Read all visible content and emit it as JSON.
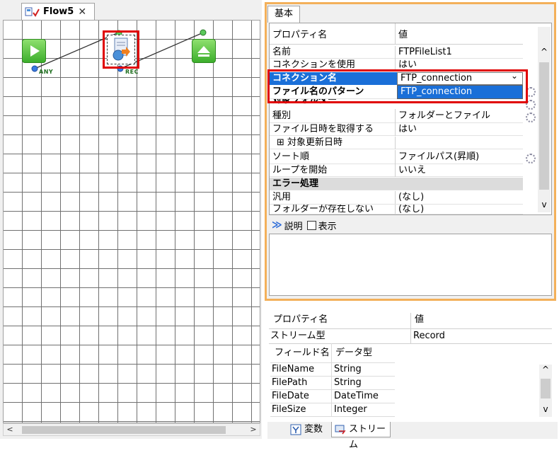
{
  "editor": {
    "tab_label": "Flow5",
    "tab_close": "✕",
    "nodes": [
      {
        "name": "start",
        "label": "ANY",
        "color": "#3cae2c"
      },
      {
        "name": "ftp-file-list",
        "label": "REC"
      },
      {
        "name": "end",
        "label": ""
      }
    ],
    "scroll_left": "<",
    "scroll_right": ">"
  },
  "properties": {
    "tab_label": "基本",
    "header_name": "プロパティ名",
    "header_value": "値",
    "rows": [
      {
        "name": "名前",
        "value": "FTPFileList1"
      },
      {
        "name": "コネクションを使用",
        "value": "はい"
      },
      {
        "name": "コネクション名",
        "value": "FTP_connection"
      },
      {
        "name": "ファイル名のパターン",
        "value": "FTP_connection"
      },
      {
        "name": "対象フォルダー",
        "value": ""
      },
      {
        "name": "種別",
        "value": "フォルダーとファイル"
      },
      {
        "name": "ファイル日時を取得する",
        "value": "はい"
      },
      {
        "name": "⊞ 対象更新日時",
        "value": ""
      },
      {
        "name": "ソート順",
        "value": "ファイルパス(昇順)"
      },
      {
        "name": "ループを開始",
        "value": "いいえ"
      },
      {
        "name": "エラー処理",
        "value": ""
      },
      {
        "name": "汎用",
        "value": "(なし)"
      },
      {
        "name": "フォルダーが存在しない",
        "value": "(なし)"
      }
    ],
    "dropdown_option": "FTP_connection",
    "dropdown_arrow": "⌄",
    "scroll_up": "^",
    "scroll_down": "v",
    "selection_color": "#1a6fd8",
    "highlight_color": "#e00000"
  },
  "description": {
    "label": "説明",
    "checkbox_label": "表示"
  },
  "stream": {
    "header_name": "プロパティ名",
    "header_value": "値",
    "type_name": "ストリーム型",
    "type_value": "Record",
    "field_header_name": "フィールド名",
    "field_header_type": "データ型",
    "fields": [
      {
        "name": "FileName",
        "type": "String"
      },
      {
        "name": "FilePath",
        "type": "String"
      },
      {
        "name": "FileDate",
        "type": "DateTime"
      },
      {
        "name": "FileSize",
        "type": "Integer"
      }
    ]
  },
  "bottom_tabs": {
    "variables": "変数",
    "streams": "ストリーム"
  }
}
